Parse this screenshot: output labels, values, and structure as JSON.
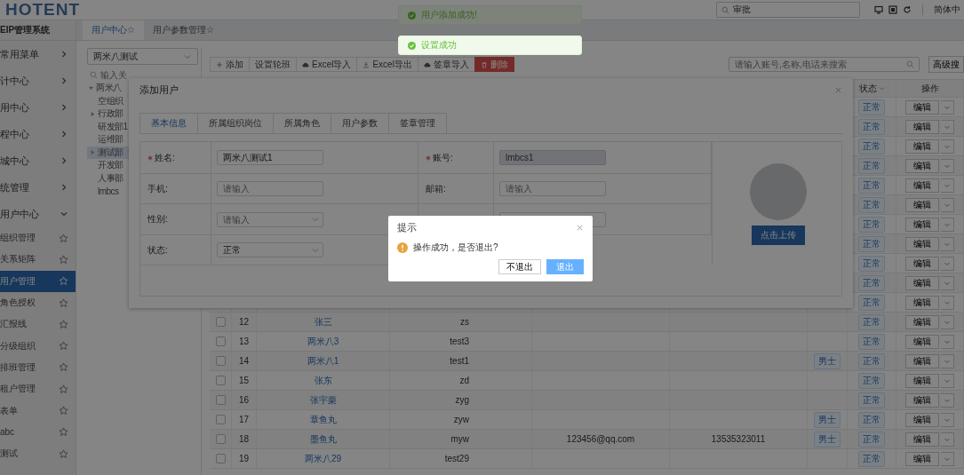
{
  "header": {
    "logo": "HOTENT",
    "search": {
      "value": "审批"
    },
    "language": "简体中"
  },
  "sidebar": {
    "title": "EIP管理系统",
    "groups": [
      {
        "label": "常用菜单",
        "expanded": false
      },
      {
        "label": "计中心",
        "expanded": false
      },
      {
        "label": "用中心",
        "expanded": false
      },
      {
        "label": "程中心",
        "expanded": false
      },
      {
        "label": "城中心",
        "expanded": false
      },
      {
        "label": "统管理",
        "expanded": false
      },
      {
        "label": "用户中心",
        "expanded": true,
        "children": [
          {
            "label": "组织管理",
            "selected": false
          },
          {
            "label": "关系矩阵",
            "selected": false
          },
          {
            "label": "用户管理",
            "selected": true
          },
          {
            "label": "角色授权",
            "selected": false
          },
          {
            "label": "汇报线",
            "selected": false
          },
          {
            "label": "分级组织",
            "selected": false
          },
          {
            "label": "排班管理",
            "selected": false
          },
          {
            "label": "租户管理",
            "selected": false
          },
          {
            "label": "表单",
            "selected": false
          },
          {
            "label": "abc",
            "selected": false
          },
          {
            "label": "测试",
            "selected": false
          }
        ]
      }
    ]
  },
  "tabs": [
    {
      "label": "用户中心☆",
      "selected": true
    },
    {
      "label": "用户参数管理☆",
      "selected": false
    }
  ],
  "tree_panel": {
    "org_select": "两米八测试",
    "filter": {
      "placeholder": "输入关"
    },
    "tree": [
      {
        "label": "两米八",
        "kind": "folder",
        "expanded": true,
        "selected": false,
        "children": [
          {
            "label": "空组织",
            "kind": "leaf",
            "selected": false
          },
          {
            "label": "行政部",
            "kind": "folder",
            "expanded": false,
            "selected": false
          },
          {
            "label": "研发部1",
            "kind": "leaf",
            "selected": false
          },
          {
            "label": "运维部",
            "kind": "leaf",
            "selected": false
          },
          {
            "label": "测试部",
            "kind": "folder",
            "expanded": false,
            "selected": true
          },
          {
            "label": "开发部",
            "kind": "leaf",
            "selected": false
          },
          {
            "label": "人事部",
            "kind": "leaf",
            "selected": false
          },
          {
            "label": "lmbcs",
            "kind": "leaf",
            "selected": false
          }
        ]
      }
    ]
  },
  "toolbar": {
    "buttons": [
      {
        "label": "添加",
        "kind": "plus"
      },
      {
        "label": "设置轮班",
        "kind": "plain"
      },
      {
        "label": "Excel导入",
        "kind": "cloud"
      },
      {
        "label": "Excel导出",
        "kind": "download"
      },
      {
        "label": "签章导入",
        "kind": "cloud"
      },
      {
        "label": "删除",
        "kind": "danger"
      }
    ],
    "search": {
      "placeholder": "请输入账号,名称,电话来搜索"
    },
    "advanced": "高级搜"
  },
  "table": {
    "columns": [
      {
        "label": "状态",
        "sortable": true
      },
      {
        "label": "操作",
        "sortable": false
      }
    ],
    "rows": [
      {
        "status": "正常",
        "action": "编辑"
      },
      {
        "status": "正常",
        "action": "编辑"
      },
      {
        "status": "正常",
        "action": "编辑"
      },
      {
        "status": "正常",
        "action": "编辑"
      },
      {
        "status": "正常",
        "action": "编辑"
      },
      {
        "status": "正常",
        "action": "编辑"
      },
      {
        "status": "正常",
        "action": "编辑"
      },
      {
        "status": "正常",
        "action": "编辑"
      },
      {
        "status": "正常",
        "action": "编辑"
      },
      {
        "status": "正常",
        "action": "编辑"
      },
      {
        "status": "正常",
        "action": "编辑"
      },
      {
        "checked": false,
        "index": "12",
        "name": "张三",
        "account": "zs",
        "status": "正常",
        "action": "编辑"
      },
      {
        "checked": false,
        "index": "13",
        "name": "两米八3",
        "account": "test3",
        "status": "正常",
        "action": "编辑"
      },
      {
        "checked": false,
        "index": "14",
        "name": "两米八1",
        "account": "test1",
        "gender": "男士",
        "status": "正常",
        "action": "编辑"
      },
      {
        "checked": false,
        "index": "15",
        "name": "张东",
        "account": "zd",
        "status": "正常",
        "action": "编辑"
      },
      {
        "checked": false,
        "index": "16",
        "name": "张宇栗",
        "account": "zyg",
        "status": "正常",
        "action": "编辑"
      },
      {
        "checked": false,
        "index": "17",
        "name": "章鱼丸",
        "account": "zyw",
        "gender": "男士",
        "status": "正常",
        "action": "编辑"
      },
      {
        "checked": false,
        "index": "18",
        "name": "墨鱼丸",
        "account": "myw",
        "email": "123456@qq.com",
        "phone": "13535323011",
        "gender": "男士",
        "status": "正常",
        "action": "编辑"
      },
      {
        "checked": false,
        "index": "19",
        "name": "两米八29",
        "account": "test29",
        "status": "正常",
        "action": "编辑"
      }
    ]
  },
  "add_user_modal": {
    "title": "添加用户",
    "tabs": [
      {
        "label": "基本信息",
        "selected": true
      },
      {
        "label": "所属组织岗位",
        "selected": false
      },
      {
        "label": "所属角色",
        "selected": false
      },
      {
        "label": "用户参数",
        "selected": false
      },
      {
        "label": "签章管理",
        "selected": false
      }
    ],
    "fields": [
      {
        "label": "姓名:",
        "required": true,
        "kind": "text",
        "value": "两米八测试1",
        "disabled": false
      },
      {
        "label": "账号:",
        "required": true,
        "kind": "text",
        "value": "lmbcs1",
        "disabled": true
      },
      {
        "label": "手机:",
        "required": false,
        "kind": "text",
        "placeholder": "请输入",
        "disabled": false
      },
      {
        "label": "邮箱:",
        "required": false,
        "kind": "text",
        "placeholder": "请输入",
        "disabled": false
      },
      {
        "label": "性别:",
        "required": false,
        "kind": "select",
        "placeholder": "请输入",
        "disabled": false
      },
      {
        "kind": "text",
        "disabled": false
      },
      {
        "label": "状态:",
        "required": false,
        "kind": "select",
        "value": "正常",
        "disabled": false
      }
    ],
    "upload_button": "点击上传"
  },
  "toasts": [
    {
      "text": "用户添加成功!",
      "dimmed": true
    },
    {
      "text": "设置成功",
      "dimmed": false
    }
  ],
  "confirm_dialog": {
    "title": "提示",
    "message": "操作成功，是否退出?",
    "buttons": [
      {
        "label": "不退出",
        "kind": "default"
      },
      {
        "label": "退出",
        "kind": "primary"
      }
    ]
  }
}
